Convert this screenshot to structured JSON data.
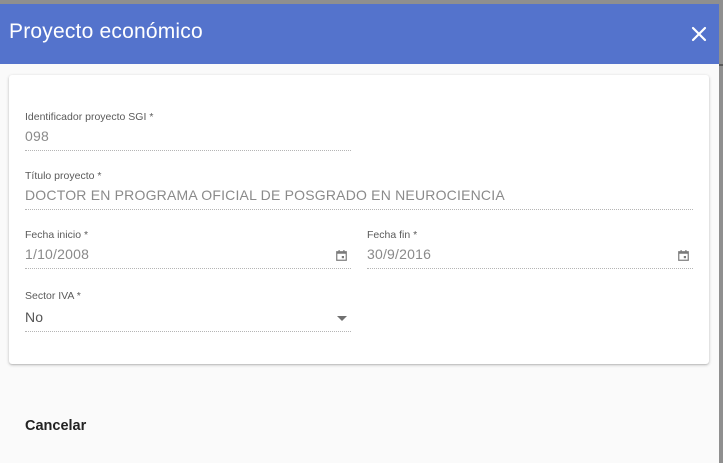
{
  "dialog": {
    "title": "Proyecto económico",
    "close_icon": "close-icon",
    "colors": {
      "header": "#5473cc",
      "header_text": "#ffffff"
    }
  },
  "form": {
    "identificador": {
      "label": "Identificador proyecto SGI *",
      "value": "098"
    },
    "titulo": {
      "label": "Título proyecto *",
      "value": "DOCTOR EN PROGRAMA OFICIAL DE POSGRADO EN NEUROCIENCIA"
    },
    "fecha_inicio": {
      "label": "Fecha inicio *",
      "value": "1/10/2008",
      "icon": "calendar-icon"
    },
    "fecha_fin": {
      "label": "Fecha fin *",
      "value": "30/9/2016",
      "icon": "calendar-icon"
    },
    "sector_iva": {
      "label": "Sector IVA *",
      "value": "No",
      "icon": "chevron-down-icon"
    }
  },
  "actions": {
    "cancel_label": "Cancelar"
  }
}
